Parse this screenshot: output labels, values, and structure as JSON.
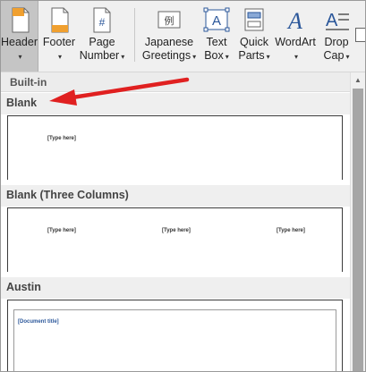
{
  "ribbon": {
    "buttons": [
      {
        "id": "header",
        "line1": "Header",
        "line2": ""
      },
      {
        "id": "footer",
        "line1": "Footer",
        "line2": ""
      },
      {
        "id": "page_number",
        "line1": "Page",
        "line2": "Number"
      },
      {
        "id": "japanese_greetings",
        "line1": "Japanese",
        "line2": "Greetings"
      },
      {
        "id": "text_box",
        "line1": "Text",
        "line2": "Box"
      },
      {
        "id": "quick_parts",
        "line1": "Quick",
        "line2": "Parts"
      },
      {
        "id": "wordart",
        "line1": "WordArt",
        "line2": ""
      },
      {
        "id": "drop_cap",
        "line1": "Drop",
        "line2": "Cap"
      }
    ],
    "caret": "▾",
    "icons": {
      "page_number_symbol": "#",
      "japanese_symbol": "例",
      "text_box_symbol": "A",
      "wordart_symbol": "A",
      "drop_cap_symbol": "A≡"
    }
  },
  "gallery": {
    "section_title": "Built-in",
    "entries": [
      {
        "name": "Blank",
        "placeholders": [
          "[Type here]"
        ]
      },
      {
        "name": "Blank (Three Columns)",
        "placeholders": [
          "[Type here]",
          "[Type here]",
          "[Type here]"
        ]
      },
      {
        "name": "Austin",
        "placeholders": [
          "[Document title]"
        ]
      }
    ]
  },
  "scrollbar": {
    "up_arrow": "▲"
  },
  "colors": {
    "ribbon_bg": "#f0f0f0",
    "active_button_bg": "#c5c5c5",
    "accent_blue": "#2b579a",
    "arrow_red": "#e02020"
  }
}
